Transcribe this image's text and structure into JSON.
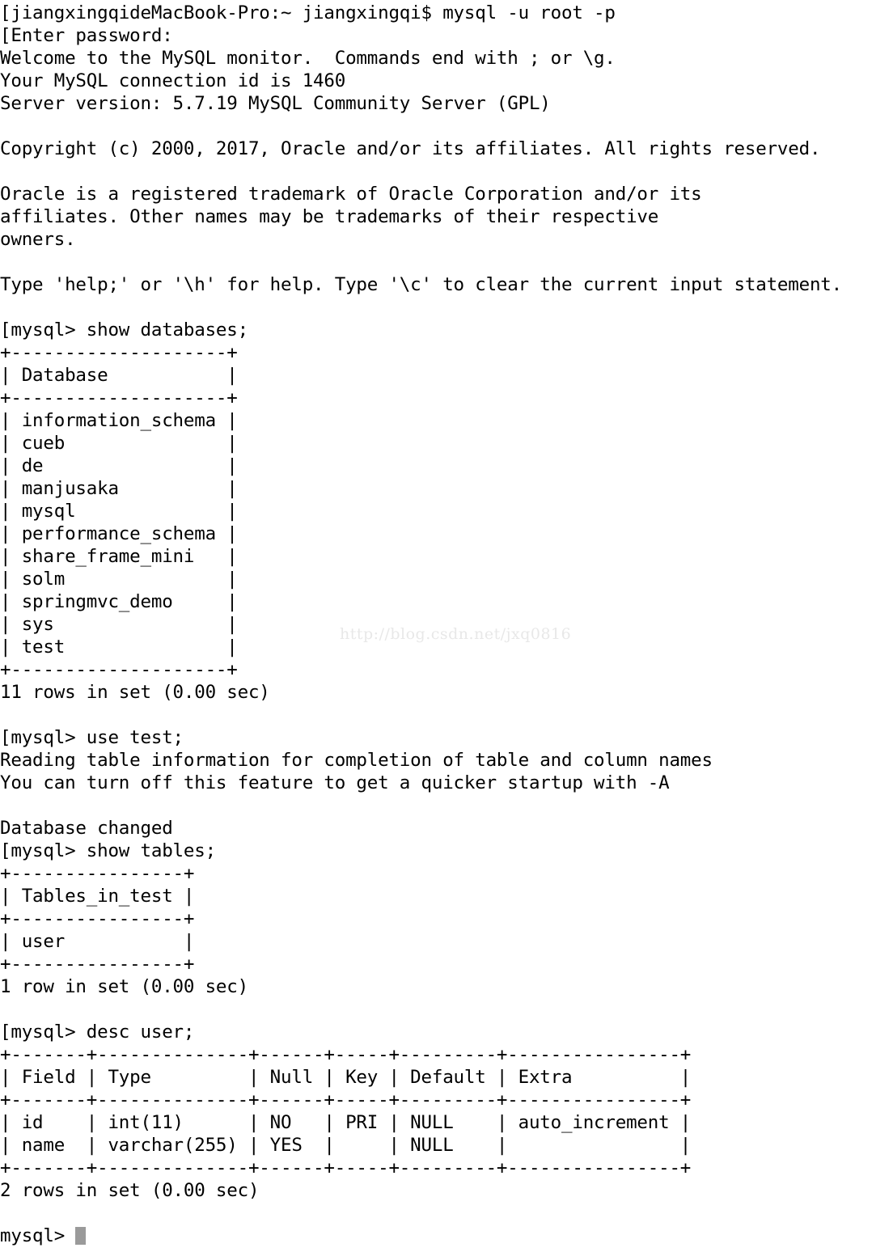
{
  "terminal": {
    "app": "Terminal",
    "shell_prompt": "jiangxingqideMacBook-Pro:~ jiangxingqi$",
    "mysql_prompt": "mysql>",
    "cursor": "block-cursor",
    "colors": {
      "background": "#ffffff",
      "foreground": "#000000",
      "cursor": "#9a9a9a",
      "watermark": "#e8e8e8"
    },
    "watermark": "http://blog.csdn.net/jxq0816",
    "lines": [
      "[jiangxingqideMacBook-Pro:~ jiangxingqi$ mysql -u root -p",
      "[Enter password:",
      "Welcome to the MySQL monitor.  Commands end with ; or \\g.",
      "Your MySQL connection id is 1460",
      "Server version: 5.7.19 MySQL Community Server (GPL)",
      "",
      "Copyright (c) 2000, 2017, Oracle and/or its affiliates. All rights reserved.",
      "",
      "Oracle is a registered trademark of Oracle Corporation and/or its",
      "affiliates. Other names may be trademarks of their respective",
      "owners.",
      "",
      "Type 'help;' or '\\h' for help. Type '\\c' to clear the current input statement.",
      "",
      "[mysql> show databases;",
      "+--------------------+",
      "| Database           |",
      "+--------------------+",
      "| information_schema |",
      "| cueb               |",
      "| de                 |",
      "| manjusaka          |",
      "| mysql              |",
      "| performance_schema |",
      "| share_frame_mini   |",
      "| solm               |",
      "| springmvc_demo     |",
      "| sys                |",
      "| test               |",
      "+--------------------+",
      "11 rows in set (0.00 sec)",
      "",
      "[mysql> use test;",
      "Reading table information for completion of table and column names",
      "You can turn off this feature to get a quicker startup with -A",
      "",
      "Database changed",
      "[mysql> show tables;",
      "+----------------+",
      "| Tables_in_test |",
      "+----------------+",
      "| user           |",
      "+----------------+",
      "1 row in set (0.00 sec)",
      "",
      "[mysql> desc user;",
      "+-------+--------------+------+-----+---------+----------------+",
      "| Field | Type         | Null | Key | Default | Extra          |",
      "+-------+--------------+------+-----+---------+----------------+",
      "| id    | int(11)      | NO   | PRI | NULL    | auto_increment |",
      "| name  | varchar(255) | YES  |     | NULL    |                |",
      "+-------+--------------+------+-----+---------+----------------+",
      "2 rows in set (0.00 sec)",
      "",
      "__PROMPT_CURSOR__"
    ],
    "session": {
      "command_1": "mysql -u root -p",
      "password_prompt": "Enter password:",
      "welcome": "Welcome to the MySQL monitor.  Commands end with ; or \\g.",
      "connection_id": "1460",
      "server_version": "5.7.19 MySQL Community Server (GPL)",
      "copyright": "Copyright (c) 2000, 2017, Oracle and/or its affiliates. All rights reserved.",
      "trademark": "Oracle is a registered trademark of Oracle Corporation and/or its affiliates. Other names may be trademarks of their respective owners.",
      "help_hint": "Type 'help;' or '\\h' for help. Type '\\c' to clear the current input statement.",
      "command_2": "show databases;",
      "databases_header": "Database",
      "databases": [
        "information_schema",
        "cueb",
        "de",
        "manjusaka",
        "mysql",
        "performance_schema",
        "share_frame_mini",
        "solm",
        "springmvc_demo",
        "sys",
        "test"
      ],
      "databases_result": "11 rows in set (0.00 sec)",
      "command_3": "use test;",
      "reading_notice_1": "Reading table information for completion of table and column names",
      "reading_notice_2": "You can turn off this feature to get a quicker startup with -A",
      "database_changed": "Database changed",
      "command_4": "show tables;",
      "tables_header": "Tables_in_test",
      "tables": [
        "user"
      ],
      "tables_result": "1 row in set (0.00 sec)",
      "command_5": "desc user;",
      "desc_columns": [
        "Field",
        "Type",
        "Null",
        "Key",
        "Default",
        "Extra"
      ],
      "desc_rows": [
        [
          "id",
          "int(11)",
          "NO",
          "PRI",
          "NULL",
          "auto_increment"
        ],
        [
          "name",
          "varchar(255)",
          "YES",
          "",
          "NULL",
          ""
        ]
      ],
      "desc_result": "2 rows in set (0.00 sec)"
    }
  }
}
